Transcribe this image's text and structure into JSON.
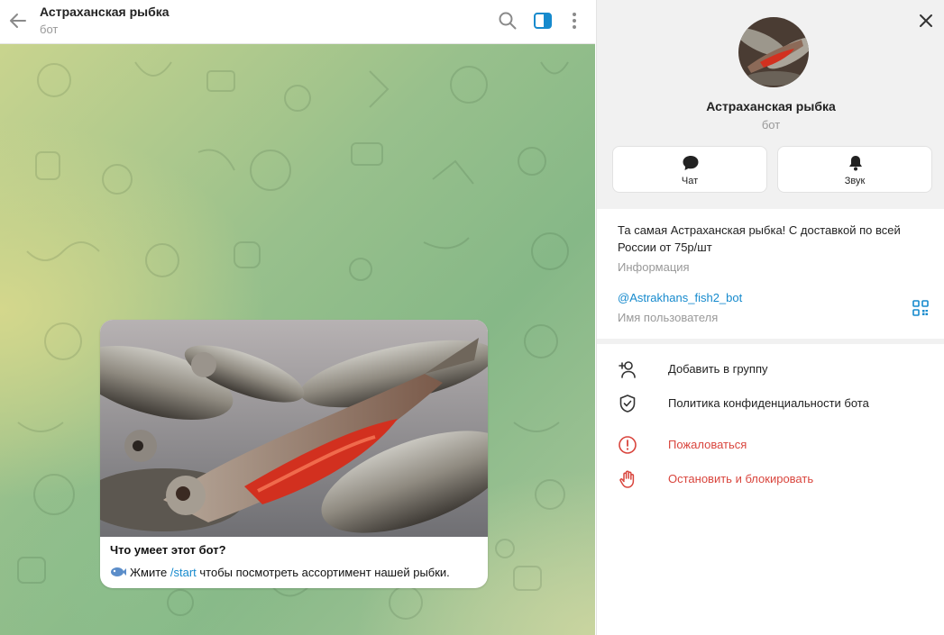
{
  "chat": {
    "title": "Астраханская рыбка",
    "subtitle": "бот",
    "message": {
      "title": "Что умеет этот бот?",
      "text_before": "Жмите",
      "command": "/start",
      "text_after": "чтобы посмотреть ассортимент нашей рыбки."
    }
  },
  "header_icons": [
    "back-arrow-icon",
    "search-icon",
    "sidebar-toggle-icon",
    "more-vertical-icon"
  ],
  "profile": {
    "name": "Астраханская рыбка",
    "subtitle": "бот",
    "actions": [
      {
        "label": "Чат",
        "icon": "chat-bubble-icon"
      },
      {
        "label": "Звук",
        "icon": "bell-icon"
      }
    ],
    "description": "Та самая Астраханская рыбка! С доставкой по всей России от 75р/шт",
    "description_label": "Информация",
    "username": "@Astrakhans_fish2_bot",
    "username_label": "Имя пользователя",
    "menu": [
      {
        "label": "Добавить в группу",
        "icon": "add-user-icon"
      },
      {
        "label": "Политика конфиденциальности бота",
        "icon": "shield-icon"
      },
      {
        "label": "Пожаловаться",
        "icon": "alert-circle-icon"
      },
      {
        "label": "Остановить и блокировать",
        "icon": "hand-stop-icon"
      }
    ]
  },
  "colors": {
    "accent": "#168acd",
    "danger": "#d9453d",
    "muted": "#999999"
  }
}
